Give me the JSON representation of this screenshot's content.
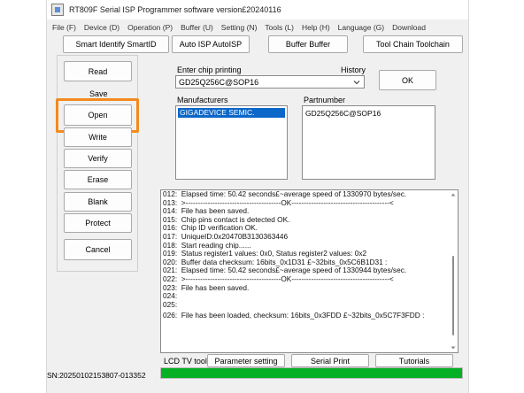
{
  "window": {
    "title": "RT809F Serial ISP Programmer software version£20240116"
  },
  "menu": [
    "File (F)",
    "Device (D)",
    "Operation (P)",
    "Buffer (U)",
    "Setting (N)",
    "Tools (L)",
    "Help (H)",
    "Language (G)",
    "Download"
  ],
  "toolbar": {
    "smart_identify": "Smart Identify SmartID",
    "auto_isp": "Auto ISP AutoISP",
    "buffer": "Buffer Buffer",
    "tool_chain": "Tool Chain Toolchain"
  },
  "side_buttons": {
    "read": "Read",
    "save": "Save",
    "open": "Open",
    "write": "Write",
    "verify": "Verify",
    "erase": "Erase",
    "blank": "Blank",
    "protect": "Protect",
    "cancel": "Cancel"
  },
  "chip": {
    "enter_label": "Enter chip printing",
    "history_label": "History",
    "value": "GD25Q256C@SOP16",
    "ok_label": "OK"
  },
  "manufacturers": {
    "label": "Manufacturers",
    "selected": "GIGADEVICE SEMIC."
  },
  "partnumber": {
    "label": "Partnumber",
    "value": "GD25Q256C@SOP16"
  },
  "log": [
    "012:  Elapsed time: 50.42 seconds£~average speed of 1330970 bytes/sec.",
    "013:  >---------------------------------------OK----------------------------------------<",
    "014:  File has been saved.",
    "015:  Chip pins contact is detected OK.",
    "016:  Chip ID verification OK.",
    "017:  UniqueID:0x20470B3130363446",
    "018:  Start reading chip......",
    "019:  Status register1 values: 0x0, Status register2 values: 0x2",
    "020:  Buffer data checksum: 16bits_0x1D31 £~32bits_0x5C6B1D31 :",
    "021:  Elapsed time: 50.42 seconds£~average speed of 1330944 bytes/sec.",
    "022:  >---------------------------------------OK----------------------------------------<",
    "023:  File has been saved.",
    "024:",
    "025:",
    "026:  File has been loaded, checksum: 16bits_0x3FDD £~32bits_0x5C7F3FDD :"
  ],
  "bottom_buttons": {
    "lcd_tv_tool": "LCD TV tool",
    "parameter_setting": "Parameter setting",
    "serial_print": "Serial Print",
    "tutorials": "Tutorials"
  },
  "status": {
    "sn": "SN:20250102153807-013352",
    "progress": 1.0,
    "progress_color": "#06b025"
  },
  "colors": {
    "highlight": "#f28a1e",
    "selection": "#0b67c8"
  }
}
